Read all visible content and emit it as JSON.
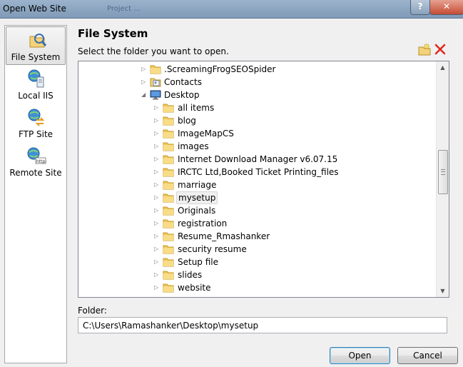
{
  "window": {
    "title": "Open Web Site",
    "ghost_tabs": [
      "Project ..."
    ],
    "help_glyph": "?",
    "close_glyph": "✕"
  },
  "nav": {
    "items": [
      {
        "label": "File System",
        "icon": "file-system-icon",
        "active": true
      },
      {
        "label": "Local IIS",
        "icon": "local-iis-icon",
        "active": false
      },
      {
        "label": "FTP Site",
        "icon": "ftp-site-icon",
        "active": false
      },
      {
        "label": "Remote Site",
        "icon": "remote-site-icon",
        "active": false
      }
    ]
  },
  "header": {
    "title": "File System",
    "instruction": "Select the folder you want to open.",
    "new_folder_icon": "new-folder-icon",
    "delete_icon": "delete-icon"
  },
  "tree": {
    "nodes": [
      {
        "label": ".ScreamingFrogSEOSpider",
        "depth": 0,
        "expander": "▷",
        "icon": "folder"
      },
      {
        "label": "Contacts",
        "depth": 0,
        "expander": "▷",
        "icon": "contacts"
      },
      {
        "label": "Desktop",
        "depth": 0,
        "expander": "◢",
        "icon": "desktop"
      },
      {
        "label": "all items",
        "depth": 1,
        "expander": "▷",
        "icon": "folder"
      },
      {
        "label": "blog",
        "depth": 1,
        "expander": "▷",
        "icon": "folder"
      },
      {
        "label": "ImageMapCS",
        "depth": 1,
        "expander": "▷",
        "icon": "folder"
      },
      {
        "label": "images",
        "depth": 1,
        "expander": "▷",
        "icon": "folder"
      },
      {
        "label": "Internet Download Manager v6.07.15",
        "depth": 1,
        "expander": "▷",
        "icon": "folder"
      },
      {
        "label": "IRCTC Ltd,Booked Ticket Printing_files",
        "depth": 1,
        "expander": "▷",
        "icon": "folder"
      },
      {
        "label": "marriage",
        "depth": 1,
        "expander": "▷",
        "icon": "folder"
      },
      {
        "label": "mysetup",
        "depth": 1,
        "expander": "▷",
        "icon": "folder",
        "selected": true
      },
      {
        "label": "Originals",
        "depth": 1,
        "expander": "▷",
        "icon": "folder"
      },
      {
        "label": "registration",
        "depth": 1,
        "expander": "▷",
        "icon": "folder"
      },
      {
        "label": "Resume_Rmashanker",
        "depth": 1,
        "expander": "▷",
        "icon": "folder"
      },
      {
        "label": "security resume",
        "depth": 1,
        "expander": "▷",
        "icon": "folder"
      },
      {
        "label": "Setup file",
        "depth": 1,
        "expander": "▷",
        "icon": "folder"
      },
      {
        "label": "slides",
        "depth": 1,
        "expander": "▷",
        "icon": "folder"
      },
      {
        "label": "website",
        "depth": 1,
        "expander": "▷",
        "icon": "folder"
      }
    ],
    "scroll_up": "▲",
    "scroll_down": "▼"
  },
  "folder_field": {
    "label": "Folder:",
    "value": "C:\\Users\\Ramashanker\\Desktop\\mysetup"
  },
  "buttons": {
    "open": "Open",
    "cancel": "Cancel"
  }
}
